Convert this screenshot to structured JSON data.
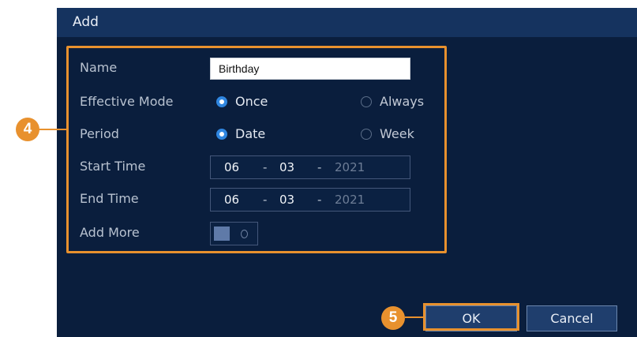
{
  "dialog": {
    "title": "Add",
    "fields": {
      "name": {
        "label": "Name",
        "value": "Birthday"
      },
      "effective_mode": {
        "label": "Effective Mode",
        "options": [
          "Once",
          "Always"
        ],
        "selected": "Once"
      },
      "period": {
        "label": "Period",
        "options": [
          "Date",
          "Week"
        ],
        "selected": "Date"
      },
      "start_time": {
        "label": "Start Time",
        "month": "06",
        "day": "03",
        "year": "2021",
        "separator": "-"
      },
      "end_time": {
        "label": "End Time",
        "month": "06",
        "day": "03",
        "year": "2021",
        "separator": "-"
      },
      "add_more": {
        "label": "Add More",
        "enabled": false
      }
    },
    "buttons": {
      "ok": "OK",
      "cancel": "Cancel"
    }
  },
  "callouts": {
    "fields_step": "4",
    "ok_step": "5"
  },
  "colors": {
    "callout": "#e8912e",
    "dialog_background": "#0a1e3d",
    "title_bar": "#15335f",
    "radio_selected": "#2f86e0"
  }
}
